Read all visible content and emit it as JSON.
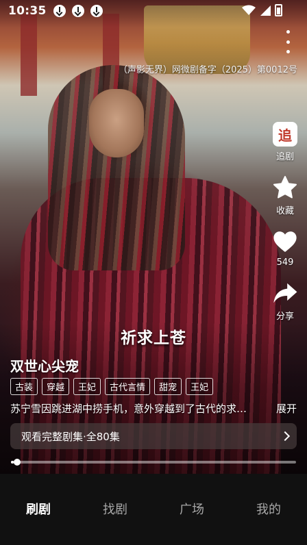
{
  "status_bar": {
    "time": "10:35",
    "download_icons": [
      "download-icon",
      "download-icon",
      "download-icon"
    ]
  },
  "license_text": "（声影无界）网微剧备字（2025）第0012号",
  "actions": {
    "follow_label": "追剧",
    "follow_icon_text": "追",
    "favorite_label": "收藏",
    "like_count": "549",
    "share_label": "分享"
  },
  "video": {
    "subtitle": "祈求上苍",
    "progress": 0.01
  },
  "drama": {
    "title": "双世心尖宠",
    "tags": [
      "古装",
      "穿越",
      "王妃",
      "古代言情",
      "甜宠",
      "王妃"
    ],
    "description": "苏宁雪因跳进湖中捞手机，意外穿越到了古代的求…",
    "expand_label": "展开",
    "watch_full_label": "观看完整剧集·全80集"
  },
  "bottom_nav": {
    "items": [
      "刷剧",
      "找剧",
      "广场",
      "我的"
    ],
    "active_index": 0
  },
  "colors": {
    "follow_icon_accent": "#c0392b",
    "nav_active": "#ffffff",
    "nav_inactive": "#a8a8a8"
  }
}
